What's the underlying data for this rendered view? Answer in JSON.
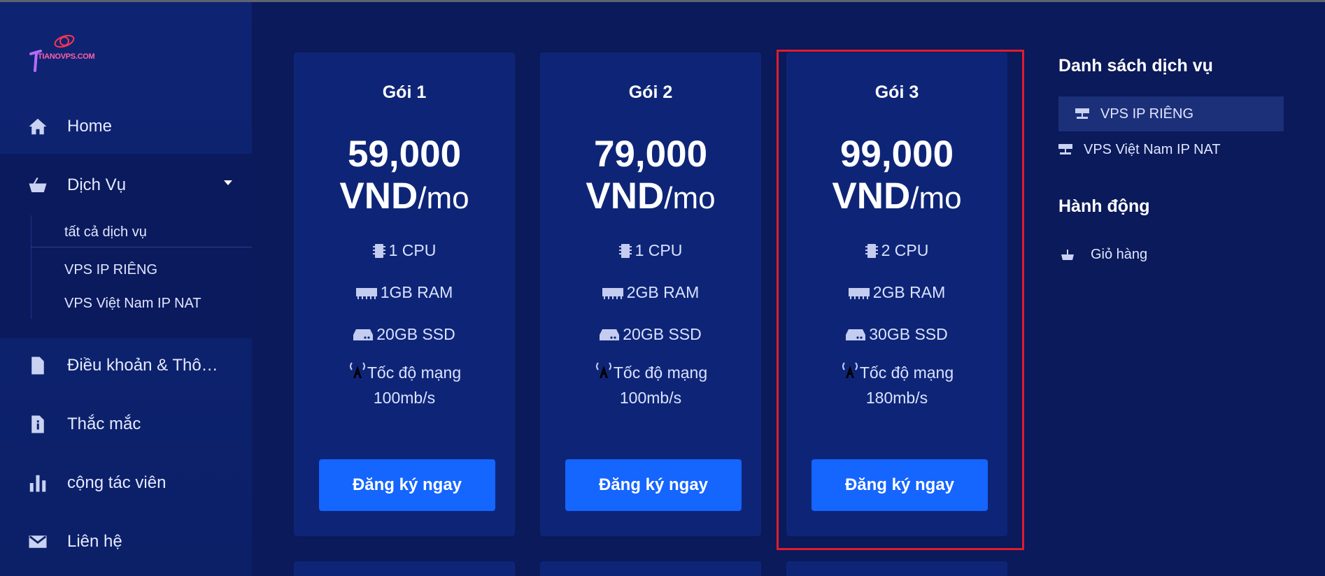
{
  "logo": {
    "text": "TIANOVPS.COM"
  },
  "sidebar": {
    "items": [
      {
        "label": "Home",
        "icon": "home-icon"
      },
      {
        "label": "Dịch Vụ",
        "icon": "basket-icon"
      },
      {
        "label": "Điều khoản & Thô…",
        "icon": "document-icon"
      },
      {
        "label": "Thắc mắc",
        "icon": "info-file-icon"
      },
      {
        "label": "cộng tác viên",
        "icon": "bar-chart-icon"
      },
      {
        "label": "Liên hệ",
        "icon": "envelope-icon"
      }
    ],
    "subitems": [
      {
        "label": "tất cả dịch vụ"
      },
      {
        "label": "VPS IP RIÊNG"
      },
      {
        "label": "VPS Việt Nam IP NAT"
      }
    ]
  },
  "plans": [
    {
      "title": "Gói 1",
      "price": "59,000",
      "currency": "VND",
      "period": "/mo",
      "cpu": "1 CPU",
      "ram": "1GB RAM",
      "ssd": "20GB SSD",
      "net_label": "Tốc độ mạng",
      "net_speed": "100mb/s",
      "cta": "Đăng ký ngay"
    },
    {
      "title": "Gói 2",
      "price": "79,000",
      "currency": "VND",
      "period": "/mo",
      "cpu": "1 CPU",
      "ram": "2GB RAM",
      "ssd": "20GB SSD",
      "net_label": "Tốc độ mạng",
      "net_speed": "100mb/s",
      "cta": "Đăng ký ngay"
    },
    {
      "title": "Gói 3",
      "price": "99,000",
      "currency": "VND",
      "period": "/mo",
      "cpu": "2 CPU",
      "ram": "2GB RAM",
      "ssd": "30GB SSD",
      "net_label": "Tốc độ mạng",
      "net_speed": "180mb/s",
      "cta": "Đăng ký ngay"
    }
  ],
  "right_panel": {
    "services_heading": "Danh sách dịch vụ",
    "services": [
      {
        "label": "VPS IP RIÊNG",
        "active": true
      },
      {
        "label": "VPS Việt Nam IP NAT",
        "active": false
      }
    ],
    "actions_heading": "Hành động",
    "actions": [
      {
        "label": "Giỏ hàng"
      }
    ]
  },
  "colors": {
    "background": "#0a1a5a",
    "sidebar": "#0e2473",
    "card": "#0e2577",
    "button": "#1565ff",
    "highlight": "#e01b2e"
  }
}
